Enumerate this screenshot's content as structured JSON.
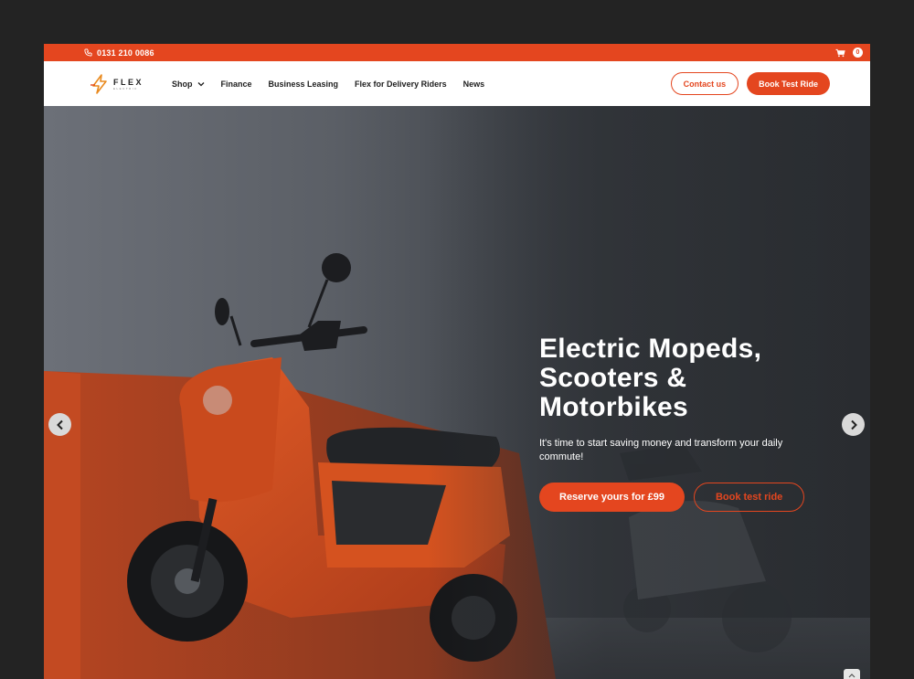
{
  "topbar": {
    "phone": "0131 210 0086",
    "cart_count": "0",
    "phone_icon": "phone-icon",
    "cart_icon": "cart-icon"
  },
  "logo": {
    "word": "FLEX",
    "sub": "ELECTRIC"
  },
  "nav": {
    "items": [
      {
        "label": "Shop"
      },
      {
        "label": "Finance"
      },
      {
        "label": "Business Leasing"
      },
      {
        "label": "Flex for Delivery Riders"
      },
      {
        "label": "News"
      }
    ],
    "contact_label": "Contact us",
    "book_label": "Book Test Ride"
  },
  "hero": {
    "title_line1": "Electric Mopeds,",
    "title_line2": "Scooters &",
    "title_line3": "Motorbikes",
    "subtitle": "It's time to start saving money and transform your daily commute!",
    "primary_cta": "Reserve yours for £99",
    "secondary_cta": "Book test ride"
  },
  "colors": {
    "accent": "#e4461f",
    "background": "#232323"
  }
}
